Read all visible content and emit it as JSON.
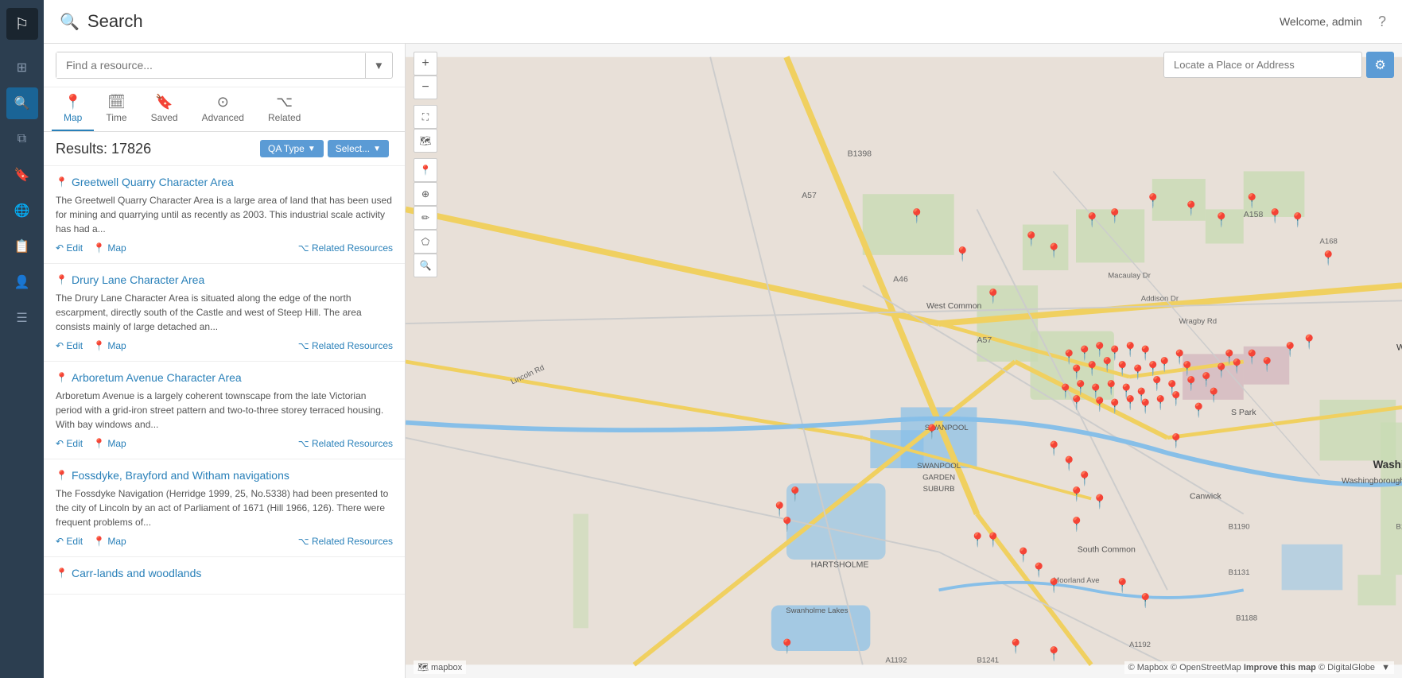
{
  "app": {
    "title": "Search",
    "welcome": "Welcome, admin",
    "help_label": "?"
  },
  "sidebar": {
    "icons": [
      {
        "name": "logo-icon",
        "symbol": "⬛",
        "active": false
      },
      {
        "name": "dashboard-icon",
        "symbol": "⊞",
        "active": false
      },
      {
        "name": "search-icon",
        "symbol": "🔍",
        "active": true
      },
      {
        "name": "layers-icon",
        "symbol": "⧉",
        "active": false
      },
      {
        "name": "bookmark-icon",
        "symbol": "🔖",
        "active": false
      },
      {
        "name": "globe-icon",
        "symbol": "🌐",
        "active": false
      },
      {
        "name": "report-icon",
        "symbol": "📋",
        "active": false
      },
      {
        "name": "user-icon",
        "symbol": "👤",
        "active": false
      },
      {
        "name": "menu-icon",
        "symbol": "☰",
        "active": false
      }
    ]
  },
  "search": {
    "placeholder": "Find a resource...",
    "dropdown_arrow": "▼"
  },
  "tabs": [
    {
      "id": "map",
      "label": "Map",
      "icon": "📍",
      "active": true
    },
    {
      "id": "time",
      "label": "Time",
      "icon": "🗓",
      "active": false
    },
    {
      "id": "saved",
      "label": "Saved",
      "icon": "🔖",
      "active": false
    },
    {
      "id": "advanced",
      "label": "Advanced",
      "icon": "⊙",
      "active": false
    },
    {
      "id": "related",
      "label": "Related",
      "icon": "⌥",
      "active": false
    }
  ],
  "results": {
    "count_label": "Results: 17826",
    "filters": [
      {
        "label": "QA Type",
        "has_arrow": true
      },
      {
        "label": "Select...",
        "has_arrow": true
      }
    ]
  },
  "result_items": [
    {
      "id": "r1",
      "title": "Greetwell Quarry Character Area",
      "description": "The Greetwell Quarry Character Area is a large area of land that has been used for mining and quarrying until as recently as 2003. This industrial scale activity has had a...",
      "actions": [
        "Edit",
        "Map"
      ],
      "related_label": "Related Resources"
    },
    {
      "id": "r2",
      "title": "Drury Lane Character Area",
      "description": "The Drury Lane Character Area is situated along the edge of the north escarpment, directly south of the Castle and west of Steep Hill. The area consists mainly of large detached an...",
      "actions": [
        "Edit",
        "Map"
      ],
      "related_label": "Related Resources"
    },
    {
      "id": "r3",
      "title": "Arboretum Avenue Character Area",
      "description": "Arboretum Avenue is a largely coherent townscape from the late Victorian period with a grid-iron street pattern and two-to-three storey terraced housing. With bay windows and...",
      "actions": [
        "Edit",
        "Map"
      ],
      "related_label": "Related Resources"
    },
    {
      "id": "r4",
      "title": "Fossdyke, Brayford and Witham navigations",
      "description": "The Fossdyke Navigation (Herridge 1999, 25, No.5338) had been presented to the city of Lincoln by an act of Parliament of 1671 (Hill 1966, 126). There were frequent problems of...",
      "actions": [
        "Edit",
        "Map"
      ],
      "related_label": "Related Resources"
    },
    {
      "id": "r5",
      "title": "Carr-lands and woodlands",
      "description": "",
      "actions": [
        "Edit",
        "Map"
      ],
      "related_label": "Related Resources"
    }
  ],
  "map": {
    "locate_placeholder": "Locate a Place or Address",
    "settings_icon": "⚙",
    "controls": [
      {
        "label": "+",
        "name": "zoom-in"
      },
      {
        "label": "−",
        "name": "zoom-out"
      },
      {
        "label": "⛶",
        "name": "fullscreen"
      },
      {
        "label": "🗺",
        "name": "layer-toggle"
      },
      {
        "label": "📍",
        "name": "pin-tool"
      },
      {
        "label": "⊕",
        "name": "locate-me"
      },
      {
        "label": "✏",
        "name": "draw-tool"
      },
      {
        "label": "⬠",
        "name": "polygon-tool"
      },
      {
        "label": "🔍",
        "name": "search-map"
      }
    ],
    "copyright": "© Mapbox © OpenStreetMap Improve this map © DigitalGlobe",
    "mapbox_logo": "🗺 mapbox"
  }
}
